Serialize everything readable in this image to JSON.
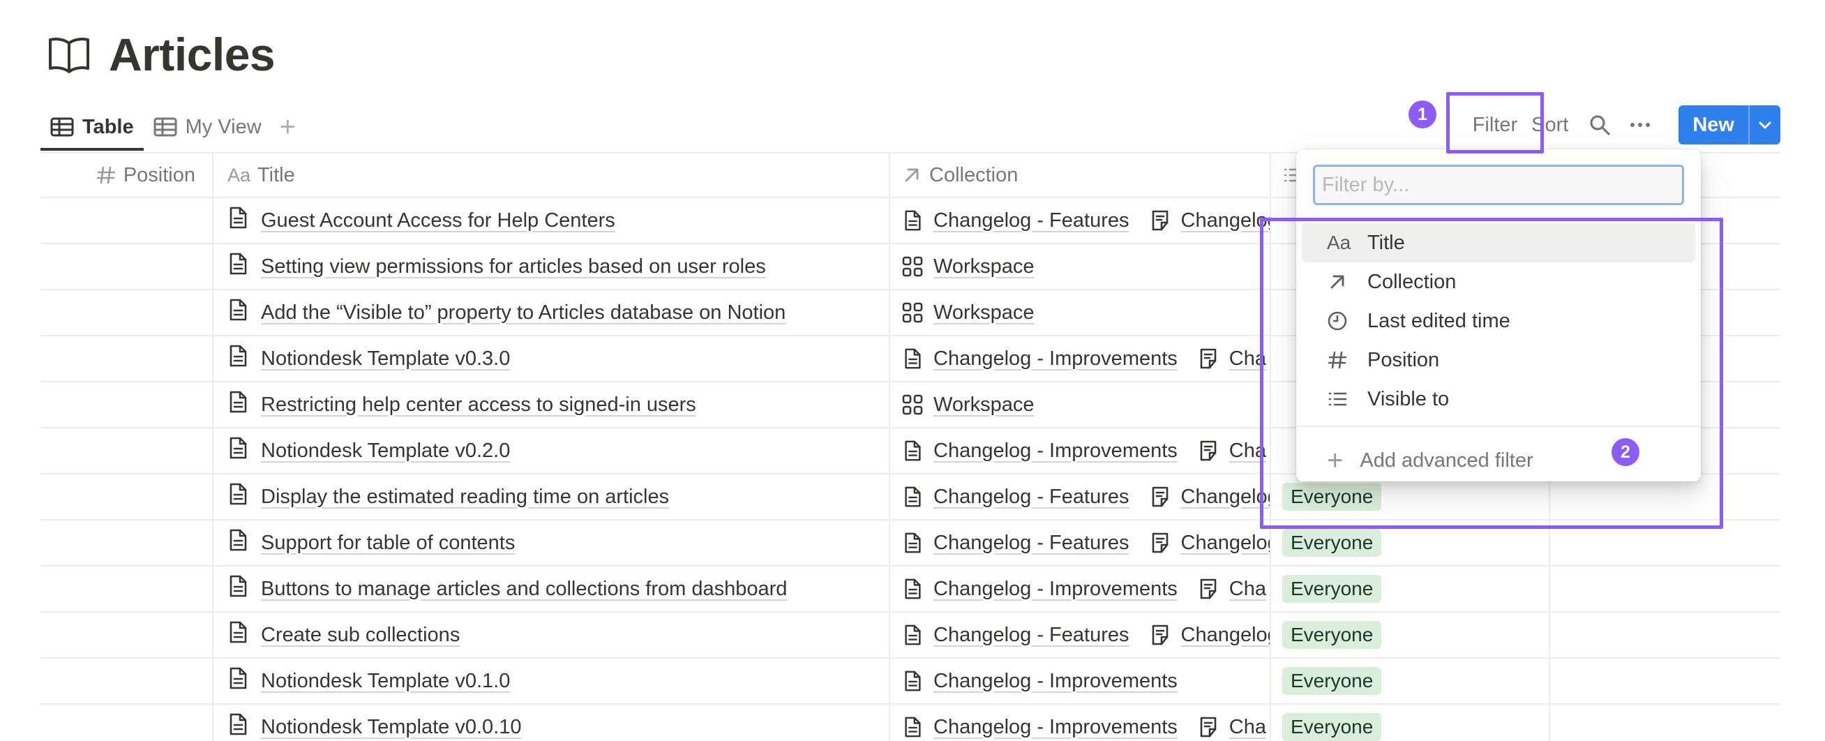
{
  "page": {
    "title": "Articles",
    "icon": "book-icon"
  },
  "views": [
    {
      "label": "Table",
      "icon": "table-icon",
      "active": true
    },
    {
      "label": "My View",
      "icon": "table-icon",
      "active": false
    }
  ],
  "add_view_label": "+",
  "toolbar": {
    "filter_label": "Filter",
    "sort_label": "Sort",
    "new_label": "New"
  },
  "columns": {
    "position": "Position",
    "title": "Title",
    "title_prefix": "Aa",
    "collection": "Collection"
  },
  "rows": [
    {
      "title": "Guest Account Access for Help Centers",
      "collections": [
        {
          "icon": "page-icon",
          "label": "Changelog - Features"
        },
        {
          "icon": "doc-list-icon",
          "label": "Changelog"
        }
      ],
      "visible": ""
    },
    {
      "title": "Setting view permissions for articles based on user roles",
      "collections": [
        {
          "icon": "grid-icon",
          "label": "Workspace"
        }
      ],
      "visible": ""
    },
    {
      "title": "Add the “Visible to” property to Articles database on Notion",
      "collections": [
        {
          "icon": "grid-icon",
          "label": "Workspace"
        }
      ],
      "visible": ""
    },
    {
      "title": "Notiondesk Template v0.3.0",
      "collections": [
        {
          "icon": "page-icon",
          "label": "Changelog - Improvements"
        },
        {
          "icon": "doc-list-icon",
          "label": "Cha"
        }
      ],
      "visible": ""
    },
    {
      "title": "Restricting help center access to signed-in users",
      "collections": [
        {
          "icon": "grid-icon",
          "label": "Workspace"
        }
      ],
      "visible": ""
    },
    {
      "title": "Notiondesk Template v0.2.0",
      "collections": [
        {
          "icon": "page-icon",
          "label": "Changelog - Improvements"
        },
        {
          "icon": "doc-list-icon",
          "label": "Cha"
        }
      ],
      "visible": ""
    },
    {
      "title": "Display the estimated reading time on articles",
      "collections": [
        {
          "icon": "page-icon",
          "label": "Changelog - Features"
        },
        {
          "icon": "doc-list-icon",
          "label": "Changelog"
        }
      ],
      "visible": "Everyone"
    },
    {
      "title": "Support for table of contents",
      "collections": [
        {
          "icon": "page-icon",
          "label": "Changelog - Features"
        },
        {
          "icon": "doc-list-icon",
          "label": "Changelog"
        }
      ],
      "visible": "Everyone"
    },
    {
      "title": "Buttons to manage articles and collections from dashboard",
      "collections": [
        {
          "icon": "page-icon",
          "label": "Changelog - Improvements"
        },
        {
          "icon": "doc-list-icon",
          "label": "Cha"
        }
      ],
      "visible": "Everyone"
    },
    {
      "title": "Create sub collections",
      "collections": [
        {
          "icon": "page-icon",
          "label": "Changelog - Features"
        },
        {
          "icon": "doc-list-icon",
          "label": "Changelog"
        }
      ],
      "visible": "Everyone"
    },
    {
      "title": "Notiondesk Template v0.1.0",
      "collections": [
        {
          "icon": "page-icon",
          "label": "Changelog - Improvements"
        }
      ],
      "visible": "Everyone"
    },
    {
      "title": "Notiondesk Template v0.0.10",
      "collections": [
        {
          "icon": "page-icon",
          "label": "Changelog - Improvements"
        },
        {
          "icon": "doc-list-icon",
          "label": "Cha"
        }
      ],
      "visible": "Everyone"
    }
  ],
  "filter_menu": {
    "placeholder": "Filter by...",
    "items": [
      {
        "label": "Title",
        "icon": "text-aa-icon",
        "icon_text": "Aa",
        "selected": true
      },
      {
        "label": "Collection",
        "icon": "arrow-up-right-icon",
        "selected": false
      },
      {
        "label": "Last edited time",
        "icon": "clock-icon",
        "selected": false
      },
      {
        "label": "Position",
        "icon": "hash-icon",
        "selected": false
      },
      {
        "label": "Visible to",
        "icon": "list-icon",
        "selected": false
      }
    ],
    "advanced_label": "Add advanced filter",
    "advanced_icon": "plus-icon"
  },
  "annotations": [
    {
      "label": "1"
    },
    {
      "label": "2"
    }
  ],
  "colors": {
    "accent": "#2f80ed",
    "annotation": "#8b5cf6",
    "tag_bg": "#dbeddb"
  }
}
